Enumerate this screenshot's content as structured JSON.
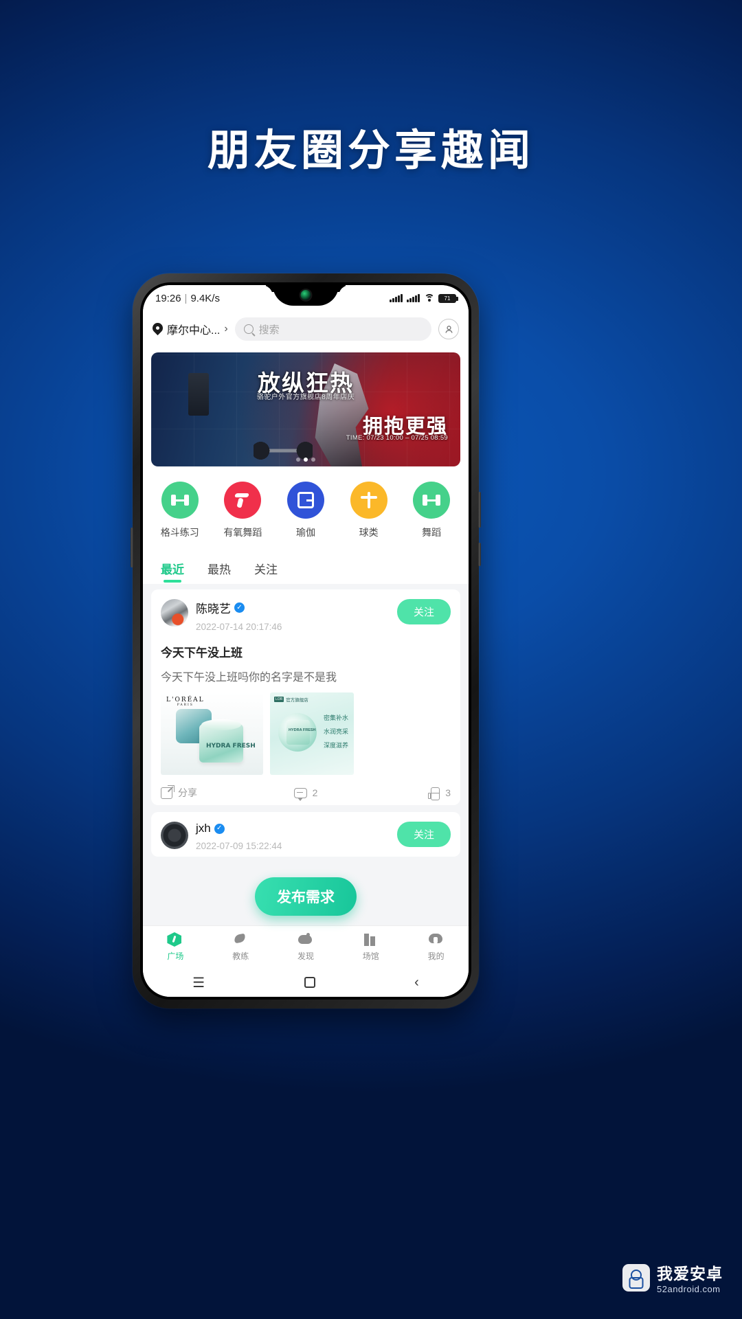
{
  "promo": {
    "title": "朋友圈分享趣闻"
  },
  "status_bar": {
    "time": "19:26",
    "separator": "|",
    "network_speed": "9.4K/s",
    "battery_level": "71",
    "icons": [
      "signal-bars-icon",
      "signal-bars-icon",
      "wifi-icon",
      "battery-icon"
    ]
  },
  "header": {
    "location_icon": "location-pin-icon",
    "location_name": "摩尔中心...",
    "chevron": "›",
    "search_icon": "search-icon",
    "search_placeholder": "搜索",
    "search_value": "",
    "profile_icon": "user-avatar-icon"
  },
  "banner": {
    "title": "放纵狂热",
    "subtitle": "骆驼户外官方旗舰店8周年店庆",
    "headline2": "拥抱更强",
    "time_text": "TIME: 07/23 10:00 – 07/25 08:59",
    "dots_total": 3,
    "dots_active_index": 1
  },
  "categories": [
    {
      "label": "格斗练习",
      "color": "#45d18a",
      "icon": "dumbbell-icon"
    },
    {
      "label": "有氧舞蹈",
      "color": "#f0304b",
      "icon": "exercise-bike-icon"
    },
    {
      "label": "瑜伽",
      "color": "#3053d8",
      "icon": "yoga-icon"
    },
    {
      "label": "球类",
      "color": "#fbb829",
      "icon": "ball-sport-icon"
    },
    {
      "label": "舞蹈",
      "color": "#45d18a",
      "icon": "dumbbell-icon"
    }
  ],
  "tabs": [
    {
      "label": "最近",
      "active": true
    },
    {
      "label": "最热",
      "active": false
    },
    {
      "label": "关注",
      "active": false
    }
  ],
  "feed": [
    {
      "user": "陈晓艺",
      "verified_icon": "verified-badge-icon",
      "timestamp": "2022-07-14 20:17:46",
      "follow_label": "关注",
      "post_title": "今天下午没上班",
      "post_body": "今天下午没上班吗你的名字是不是我",
      "images": [
        {
          "brand": "L'ORÉAL",
          "brand_sub": "PARIS",
          "product": "HYDRA FRESH"
        },
        {
          "shop_tag": "官方旗舰店",
          "product": "HYDRA FRESH",
          "bullets": [
            "密集补水",
            "水润亮采",
            "深度滋养"
          ]
        }
      ],
      "actions": {
        "share_icon": "share-icon",
        "share_label": "分享",
        "comment_icon": "comment-icon",
        "comment_count": "2",
        "like_icon": "thumbs-up-icon",
        "like_count": "3"
      }
    },
    {
      "user": "jxh",
      "verified_icon": "verified-badge-icon",
      "timestamp": "2022-07-09 15:22:44",
      "follow_label": "关注"
    }
  ],
  "fab": {
    "label": "发布需求"
  },
  "bottom_nav": [
    {
      "label": "广场",
      "icon": "plaza-icon",
      "active": true
    },
    {
      "label": "教练",
      "icon": "coach-icon",
      "active": false
    },
    {
      "label": "发现",
      "icon": "discover-icon",
      "active": false
    },
    {
      "label": "场馆",
      "icon": "venue-icon",
      "active": false
    },
    {
      "label": "我的",
      "icon": "profile-icon",
      "active": false
    }
  ],
  "system_nav": [
    {
      "icon": "menu-icon",
      "glyph": "☰"
    },
    {
      "icon": "home-square-icon",
      "glyph": ""
    },
    {
      "icon": "back-icon",
      "glyph": "‹"
    }
  ],
  "watermark": {
    "line1": "我爱安卓",
    "line2": "52android.com",
    "logo_icon": "android-robot-icon"
  },
  "colors": {
    "accent_green": "#1fc98a",
    "brand_blue": "#0a4da8",
    "verify_blue": "#1a8cf0"
  }
}
